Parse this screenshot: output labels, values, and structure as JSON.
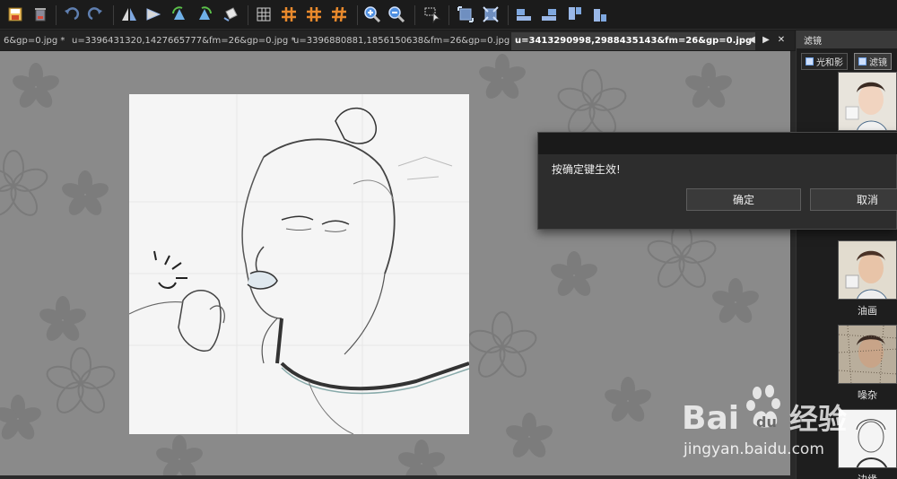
{
  "toolbar": {
    "icons": [
      "save-icon",
      "delete-icon",
      "undo-icon",
      "redo-icon",
      "flip-horizontal-icon",
      "flip-vertical-icon",
      "rotate-left-icon",
      "rotate-right-icon",
      "free-rotate-icon",
      "grid-icon",
      "grid-orange-icon",
      "grid-orange-icon",
      "grid-orange-icon",
      "zoom-in-icon",
      "zoom-out-icon",
      "select-icon",
      "crop-icon",
      "resize-icon",
      "align-left-icon",
      "align-right-icon",
      "align-top-icon",
      "align-bottom-icon"
    ]
  },
  "tabs": [
    {
      "label": "6&gp=0.jpg *",
      "active": false
    },
    {
      "label": "u=3396431320,1427665777&fm=26&gp=0.jpg *",
      "active": false
    },
    {
      "label": "u=3396880881,1856150638&fm=26&gp=0.jpg *",
      "active": false
    },
    {
      "label": "u=3413290998,2988435143&fm=26&gp=0.jpg",
      "active": true
    }
  ],
  "tab_controls": {
    "prev": "◀",
    "next": "▶",
    "close": "✕"
  },
  "panel": {
    "title": "滤镜",
    "tabs": [
      {
        "label": "光和影"
      },
      {
        "label": "滤镜"
      }
    ],
    "filters": [
      {
        "label": ""
      },
      {
        "label": "油画"
      },
      {
        "label": "噪杂"
      },
      {
        "label": "边缘"
      }
    ]
  },
  "dialog": {
    "message": "按确定键生效!",
    "ok_label": "确定",
    "cancel_label": "取消"
  },
  "watermark": {
    "brand": "Bai",
    "brand_suffix": "du",
    "cn": "经验",
    "url": "jingyan.baidu.com"
  },
  "colors": {
    "toolbar_bg": "#1b1b1b",
    "canvas_bg": "#8a8a8a",
    "accent_orange": "#e8892c",
    "accent_blue": "#4f8fe0",
    "dialog_bg": "#2d2d2d"
  }
}
